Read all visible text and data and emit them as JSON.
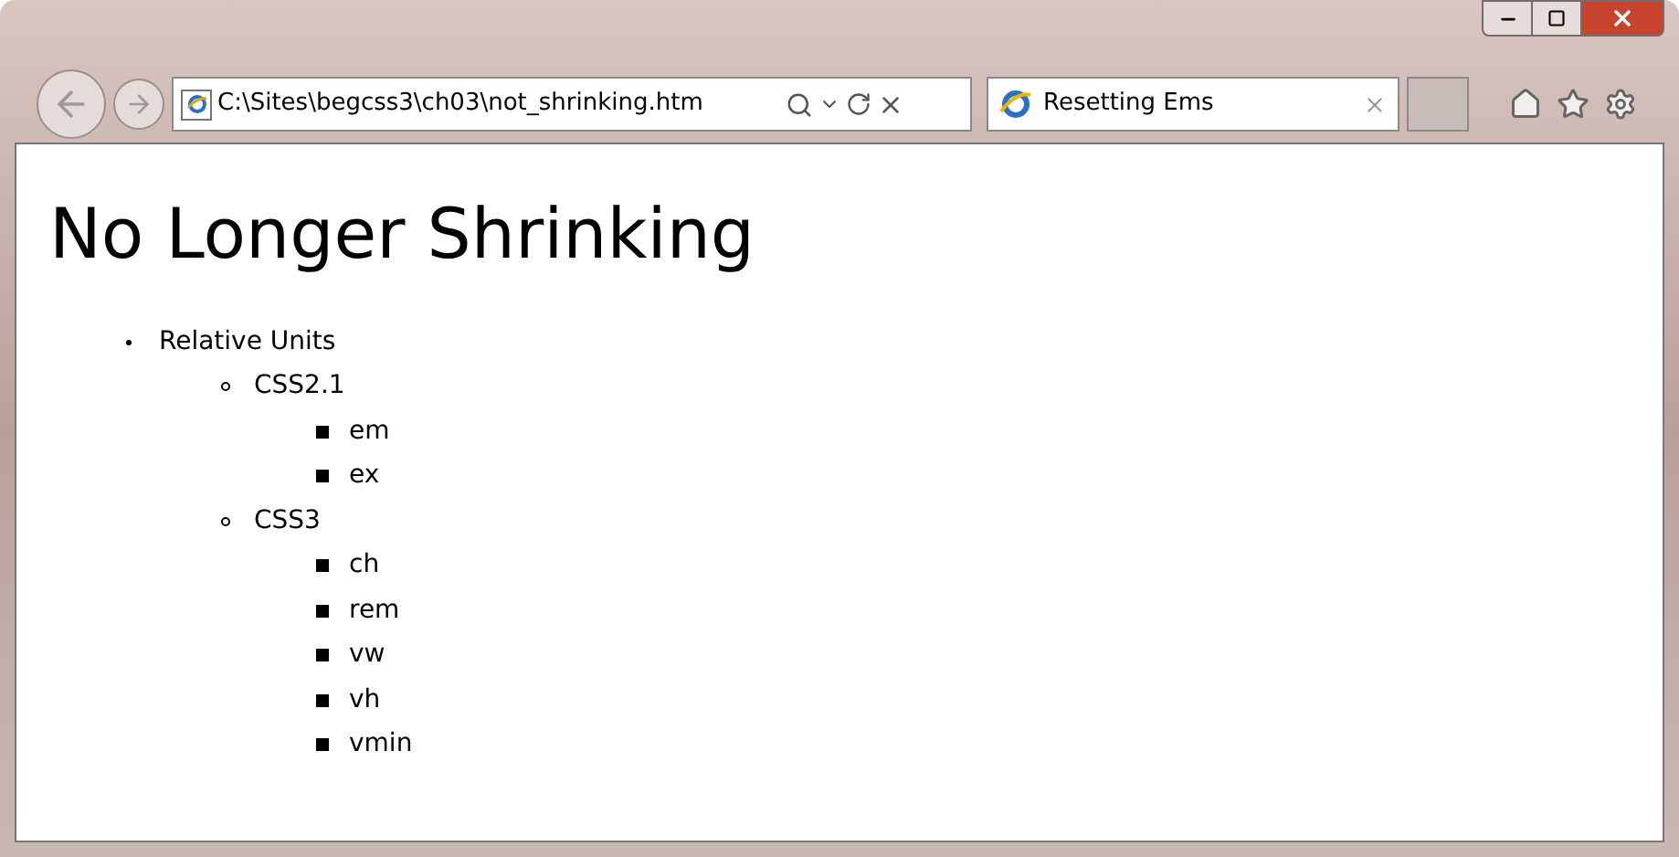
{
  "browser": {
    "address": "C:\\Sites\\begcss3\\ch03\\not_shrinking.htm",
    "tabs": [
      {
        "title": "Resetting Ems",
        "selected": true
      }
    ]
  },
  "page": {
    "heading": "No Longer Shrinking",
    "list": [
      {
        "text": "Relative Units",
        "children": [
          {
            "text": "CSS2.1",
            "children": [
              {
                "text": "em"
              },
              {
                "text": "ex"
              }
            ]
          },
          {
            "text": "CSS3",
            "children": [
              {
                "text": "ch"
              },
              {
                "text": "rem"
              },
              {
                "text": "vw"
              },
              {
                "text": "vh"
              },
              {
                "text": "vmin"
              }
            ]
          }
        ]
      }
    ]
  }
}
